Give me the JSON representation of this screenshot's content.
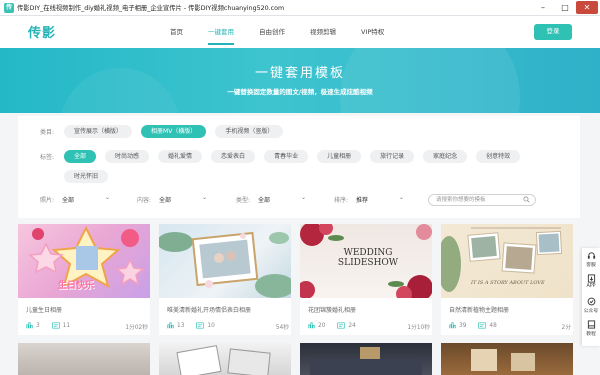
{
  "window": {
    "title": "传影DIY_在线视频制作_diy婚礼视频_电子相册_企业宣传片 - 传影DIY视频chuanying520.com",
    "app_icon": "传"
  },
  "header": {
    "logo": "传影",
    "nav": [
      "首页",
      "一键套用",
      "自由创作",
      "视频剪辑",
      "VIP特权"
    ],
    "active_nav": "一键套用",
    "login": "登录"
  },
  "banner": {
    "title": "一键套用模板",
    "subtitle": "一键替换固定数量的图文/视频，极速生成炫酷视频"
  },
  "filters": {
    "category_label": "类目:",
    "categories": [
      "宣传展示（横版）",
      "相册MV（横版）",
      "手机视频（竖版）"
    ],
    "active_category": "相册MV（横版）",
    "tag_label": "标签:",
    "tags": [
      "全部",
      "时尚动感",
      "婚礼爱情",
      "恋爱表白",
      "青春毕业",
      "儿童相册",
      "旅行记录",
      "家庭纪念",
      "创意特效",
      "时光怀旧"
    ],
    "active_tag": "全部",
    "selects": [
      {
        "label": "照片:",
        "value": "全部"
      },
      {
        "label": "内容:",
        "value": "全部"
      },
      {
        "label": "类型:",
        "value": "全部"
      },
      {
        "label": "排序:",
        "value": "推荐"
      }
    ],
    "search_placeholder": "请搜索你想要的模板"
  },
  "cards": [
    {
      "title": "儿童生日相册",
      "images": "3",
      "texts": "11",
      "duration": "1分02秒",
      "thumb_text": "生日快乐"
    },
    {
      "title": "唯美清新婚礼开场情侣表白相册",
      "images": "13",
      "texts": "10",
      "duration": "54秒",
      "thumb_text": ""
    },
    {
      "title": "花团锦簇婚礼相册",
      "images": "20",
      "texts": "24",
      "duration": "1分10秒",
      "thumb_text": "WEDDING SLIDESHOW"
    },
    {
      "title": "自然清新植物主题相册",
      "images": "39",
      "texts": "48",
      "duration": "2分",
      "thumb_text": "IT IS A STORY ABOUT LOVE"
    }
  ],
  "sidebar": [
    {
      "label": "客服",
      "icon": "headset-icon"
    },
    {
      "label": "APP",
      "icon": "download-icon"
    },
    {
      "label": "公众号",
      "icon": "wechat-icon"
    },
    {
      "label": "教程",
      "icon": "book-icon"
    }
  ],
  "colors": {
    "accent": "#2ec1b4",
    "banner": "#2fbac8",
    "close": "#c94a3c"
  }
}
